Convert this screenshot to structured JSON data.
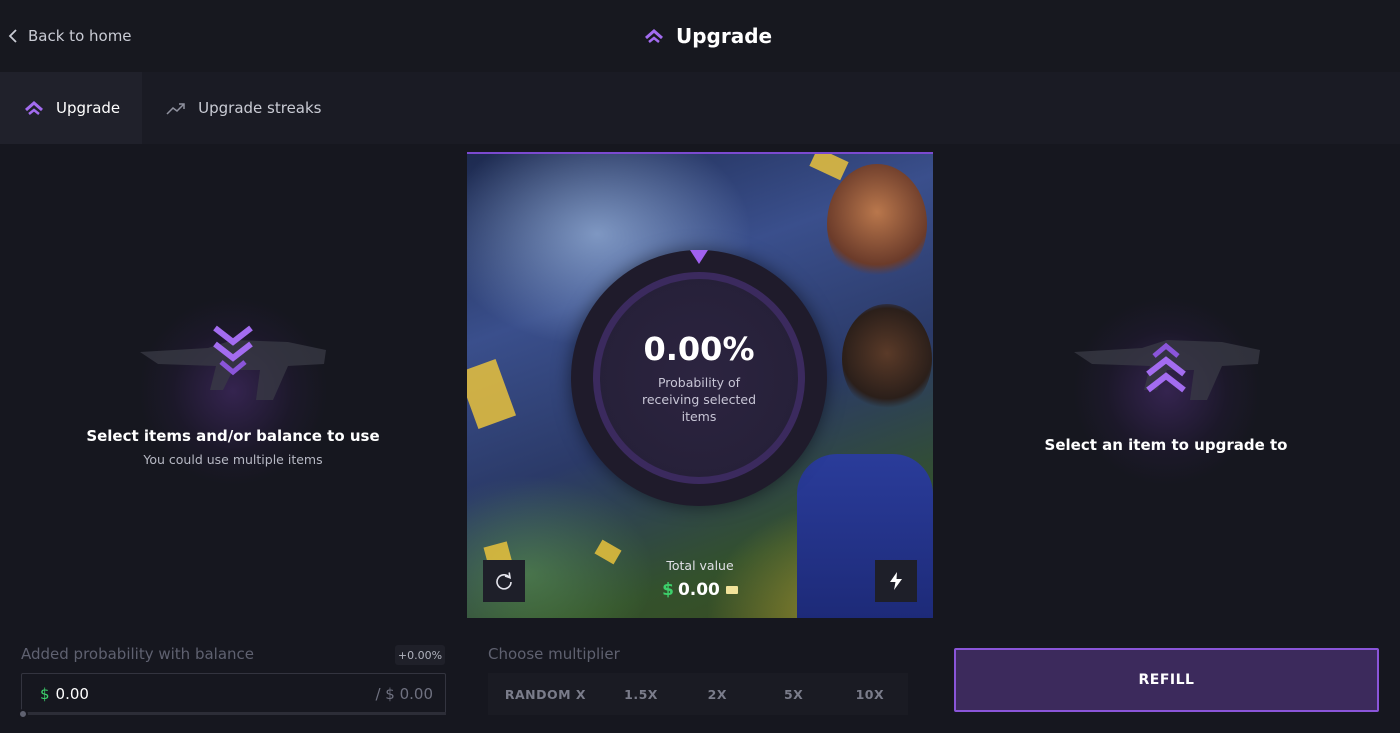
{
  "header": {
    "back_label": "Back to home",
    "title": "Upgrade"
  },
  "tabs": [
    {
      "label": "Upgrade",
      "active": true,
      "icon": "upgrade-chevrons-icon"
    },
    {
      "label": "Upgrade streaks",
      "active": false,
      "icon": "trend-up-icon"
    }
  ],
  "left_panel": {
    "title": "Select items and/or balance to use",
    "subtitle": "You could use multiple items"
  },
  "right_panel": {
    "title": "Select an item to upgrade to"
  },
  "dial": {
    "percent": "0.00%",
    "caption": "Probability of receiving selected items"
  },
  "total": {
    "label": "Total value",
    "currency": "$",
    "value": "0.00"
  },
  "balance": {
    "label": "Added probability with balance",
    "badge": "+0.00%",
    "currency": "$",
    "value": "0.00",
    "max": "/ $ 0.00",
    "slider_fraction": 0
  },
  "multiplier": {
    "label": "Choose multiplier",
    "options": [
      "RANDOM X",
      "1.5X",
      "2X",
      "5X",
      "10X"
    ]
  },
  "refill_label": "REFILL",
  "colors": {
    "accent": "#8a55d9",
    "currency_green": "#3dd06b",
    "background": "#16171f"
  }
}
